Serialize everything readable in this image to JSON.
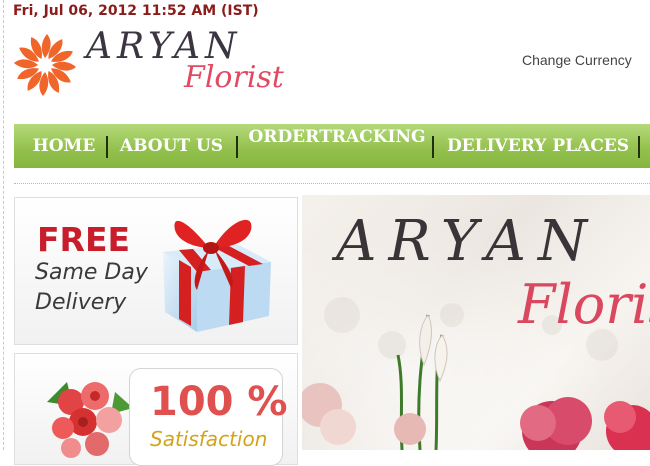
{
  "header": {
    "datetime": "Fri, Jul 06, 2012 11:52 AM (IST)",
    "logo_word": "ARYAN",
    "logo_sub": "Florist",
    "currency_link": "Change Currency"
  },
  "nav": {
    "items": [
      {
        "label": "HOME"
      },
      {
        "label": "ABOUT US"
      },
      {
        "label_line1": "ORDER",
        "label_line2": "TRACKING"
      },
      {
        "label": "DELIVERY PLACES"
      }
    ]
  },
  "promos": {
    "free": {
      "title": "FREE",
      "line1": "Same Day",
      "line2": "Delivery",
      "icon": "gift-box-icon"
    },
    "satisfaction": {
      "percent": "100 %",
      "word": "Satisfaction",
      "icon": "bouquet-icon"
    }
  },
  "banner": {
    "word": "ARYAN",
    "sub": "Florist"
  },
  "colors": {
    "brand_red": "#c81e2c",
    "nav_green": "#95c24f",
    "datetime": "#8b1c1c",
    "logo_pink": "#e04a62"
  }
}
